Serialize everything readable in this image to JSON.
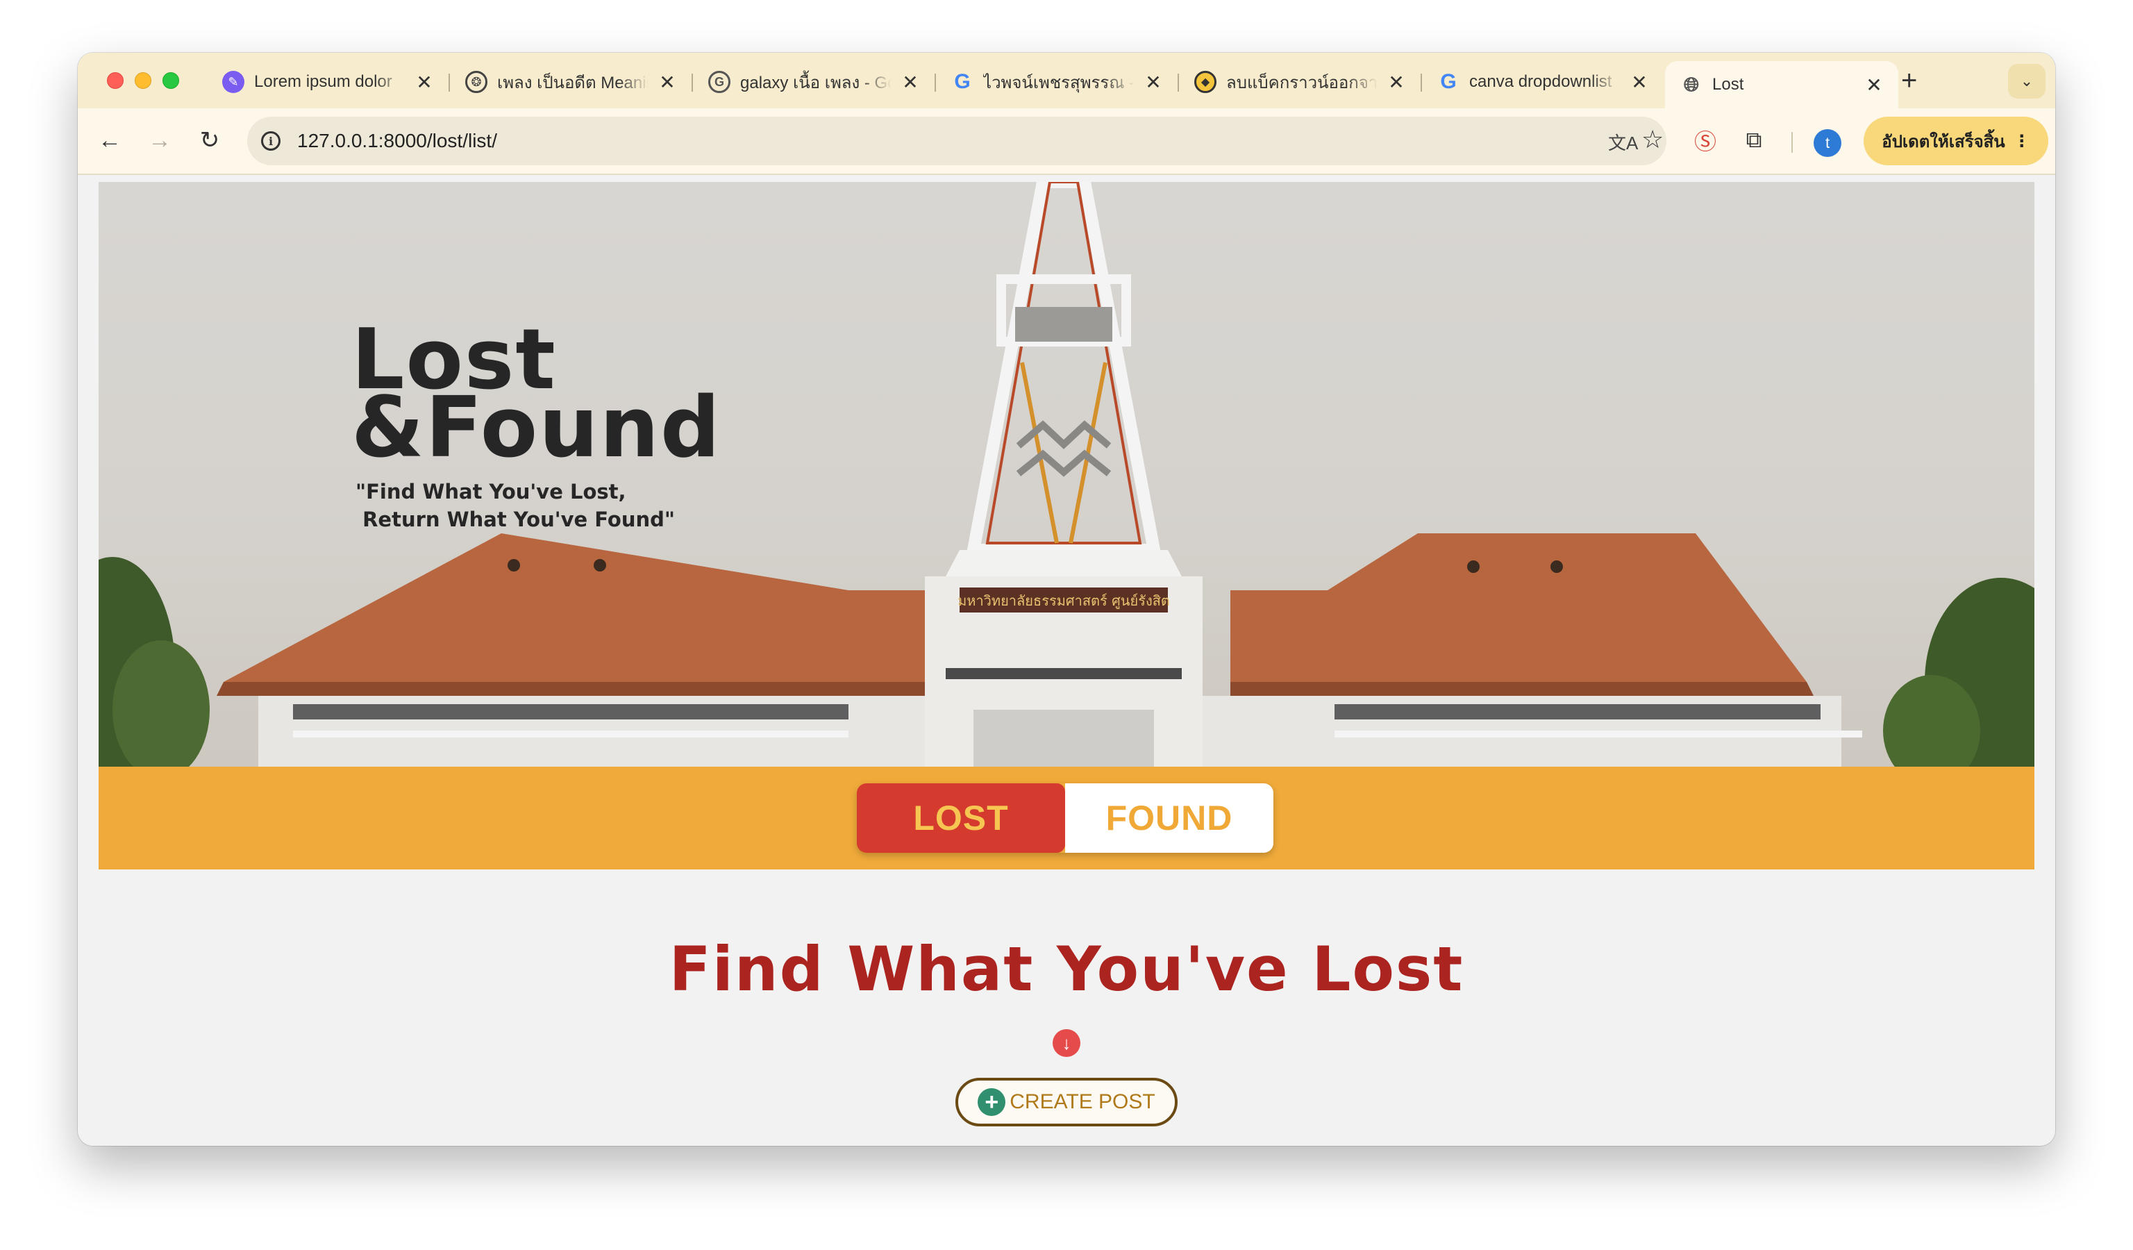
{
  "browser": {
    "tabs": [
      {
        "title": "Lorem ipsum dolor",
        "favicon": "canva-icon",
        "active": false
      },
      {
        "title": "เพลง เป็นอดีต Meaning",
        "favicon": "openai-icon",
        "active": false
      },
      {
        "title": "galaxy เนื้อ เพลง - Google",
        "favicon": "google-icon",
        "active": false
      },
      {
        "title": "ไวพจน์เพชรสุพรรณ - Google",
        "favicon": "google-icon",
        "active": false
      },
      {
        "title": "ลบแบ็คกราวน์ออกจาก",
        "favicon": "remove-bg-icon",
        "active": false
      },
      {
        "title": "canva dropdownlist",
        "favicon": "google-icon",
        "active": false
      },
      {
        "title": "Lost",
        "favicon": "globe-icon",
        "active": true
      }
    ],
    "url": "127.0.0.1:8000/lost/list/",
    "profile_initial": "t",
    "update_label": "อัปเดตให้เสร็จสิ้น"
  },
  "hero": {
    "title": "Lost\n&Found",
    "subtitle": "\"Find What You've Lost,\n Return What You've Found\"",
    "sign_text": "มหาวิทยาลัยธรรมศาสตร์ ศูนย์รังสิต"
  },
  "toggle": {
    "lost_label": "LOST",
    "found_label": "FOUND",
    "selected": "LOST"
  },
  "main": {
    "heading": "Find What You've Lost",
    "create_post_label": "CREATE POST"
  },
  "colors": {
    "accent_orange": "#f0aa3a",
    "lost_red": "#d43a2e",
    "heading_red": "#ab2420",
    "create_post_text": "#b07a1a",
    "tabstrip_bg": "#f7eccd"
  }
}
